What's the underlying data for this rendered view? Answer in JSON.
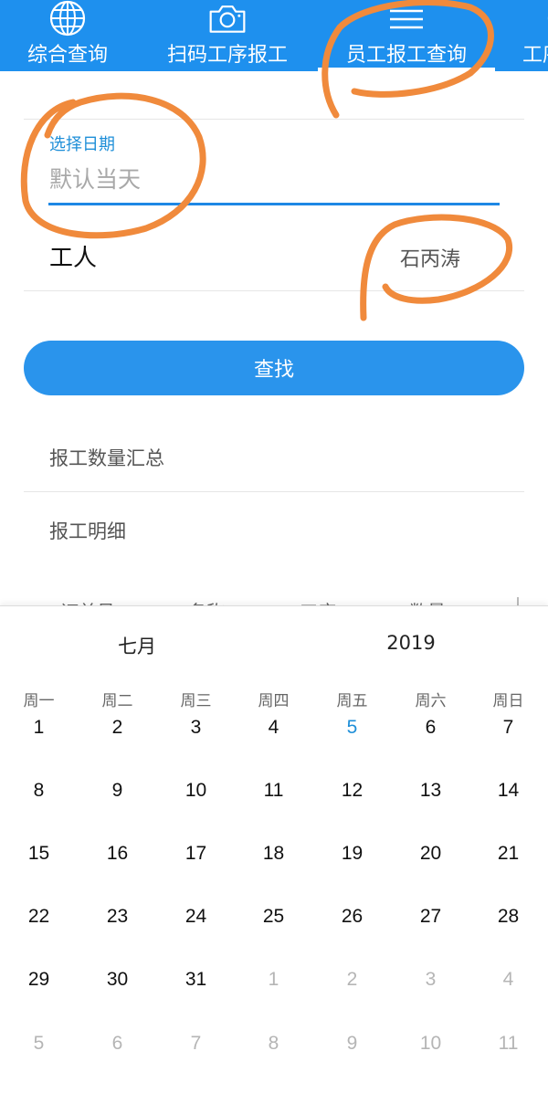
{
  "tabs": [
    {
      "label": "综合查询",
      "icon": "globe-icon"
    },
    {
      "label": "扫码工序报工",
      "icon": "camera-icon"
    },
    {
      "label": "员工报工查询",
      "icon": "menu-icon",
      "active": true
    },
    {
      "label": "工序",
      "icon": "partial-icon"
    }
  ],
  "form": {
    "date_label": "选择日期",
    "date_placeholder": "默认当天",
    "worker_label": "工人",
    "worker_value": "石丙涛",
    "search_button": "查找"
  },
  "links": {
    "summary": "报工数量汇总",
    "detail": "报工明细"
  },
  "table": {
    "columns": [
      "订单号",
      "名称",
      "工序",
      "数量"
    ]
  },
  "calendar": {
    "month": "七月",
    "year": "2019",
    "weekdays": [
      "周一",
      "周二",
      "周三",
      "周四",
      "周五",
      "周六",
      "周日"
    ],
    "weeks": [
      [
        "1",
        "2",
        "3",
        "4",
        "5",
        "6",
        "7"
      ],
      [
        "8",
        "9",
        "10",
        "11",
        "12",
        "13",
        "14"
      ],
      [
        "15",
        "16",
        "17",
        "18",
        "19",
        "20",
        "21"
      ],
      [
        "22",
        "23",
        "24",
        "25",
        "26",
        "27",
        "28"
      ],
      [
        "29",
        "30",
        "31",
        "1",
        "2",
        "3",
        "4"
      ],
      [
        "5",
        "6",
        "7",
        "8",
        "9",
        "10",
        "11"
      ]
    ],
    "today": "5"
  },
  "colors": {
    "primary": "#1e90ee",
    "accent_text": "#1f8fd8",
    "annotation": "#f08a3c"
  }
}
